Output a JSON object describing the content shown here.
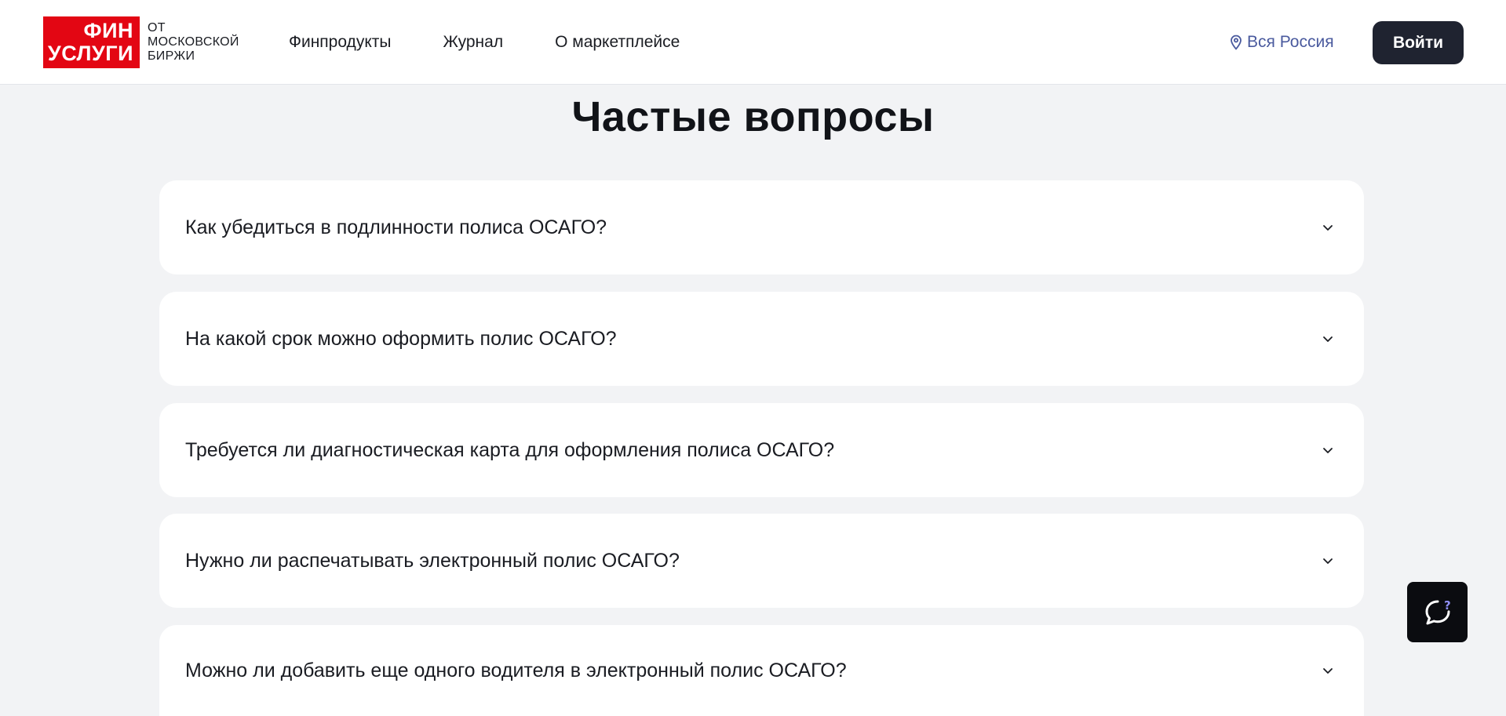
{
  "header": {
    "logo": {
      "line1": "ФИН",
      "line2": "УСЛУГИ",
      "sub1": "ОТ",
      "sub2": "МОСКОВСКОЙ",
      "sub3": "БИРЖИ",
      "brand_color": "#e30613"
    },
    "nav": [
      {
        "label": "Финпродукты"
      },
      {
        "label": "Журнал"
      },
      {
        "label": "О маркетплейсе"
      }
    ],
    "region": {
      "label": "Вся Россия",
      "icon": "location-pin-icon",
      "color": "#4a5a9e"
    },
    "login_label": "Войти"
  },
  "faq": {
    "title": "Частые вопросы",
    "items": [
      {
        "question": "Как убедиться в подлинности полиса ОСАГО?"
      },
      {
        "question": "На какой срок можно оформить полис ОСАГО?"
      },
      {
        "question": "Требуется ли диагностическая карта для оформления полиса ОСАГО?"
      },
      {
        "question": "Нужно ли распечатывать электронный полис ОСАГО?"
      },
      {
        "question": "Можно ли добавить еще одного водителя в электронный полис ОСАГО?"
      }
    ]
  },
  "help_widget": {
    "icon": "chat-question-icon"
  }
}
